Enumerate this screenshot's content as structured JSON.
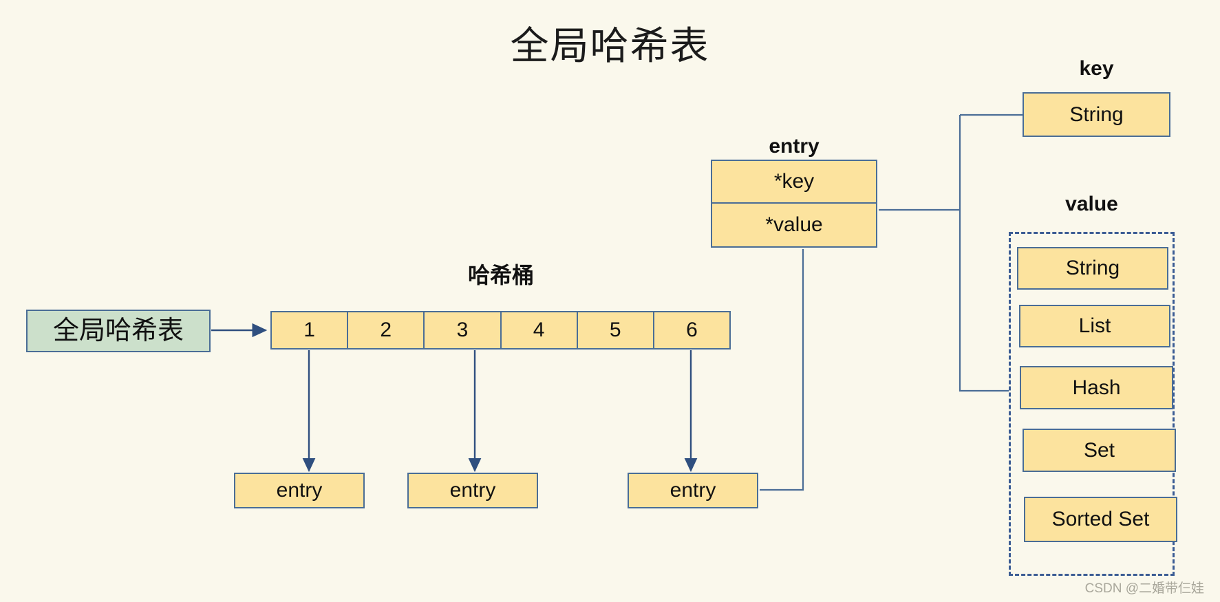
{
  "page": {
    "title": "全局哈希表",
    "background_color": "#FAF8EC",
    "box_fill_color": "#FCE39E",
    "box_border_color": "#4A6D96",
    "green_fill_color": "#CCE0CB",
    "line_color": "#4A6D96",
    "watermark": "CSDN @二婚带仨娃"
  },
  "global_table": {
    "label": "全局哈希表"
  },
  "bucket": {
    "heading": "哈希桶",
    "cells": [
      "1",
      "2",
      "3",
      "4",
      "5",
      "6"
    ]
  },
  "entries": [
    {
      "label": "entry"
    },
    {
      "label": "entry"
    },
    {
      "label": "entry"
    }
  ],
  "entry_struct": {
    "heading": "entry",
    "fields": [
      {
        "label": "*key"
      },
      {
        "label": "*value"
      }
    ]
  },
  "key_group": {
    "heading": "key",
    "types": [
      {
        "label": "String"
      }
    ]
  },
  "value_group": {
    "heading": "value",
    "types": [
      {
        "label": "String"
      },
      {
        "label": "List"
      },
      {
        "label": "Hash"
      },
      {
        "label": "Set"
      },
      {
        "label": "Sorted Set"
      }
    ]
  }
}
